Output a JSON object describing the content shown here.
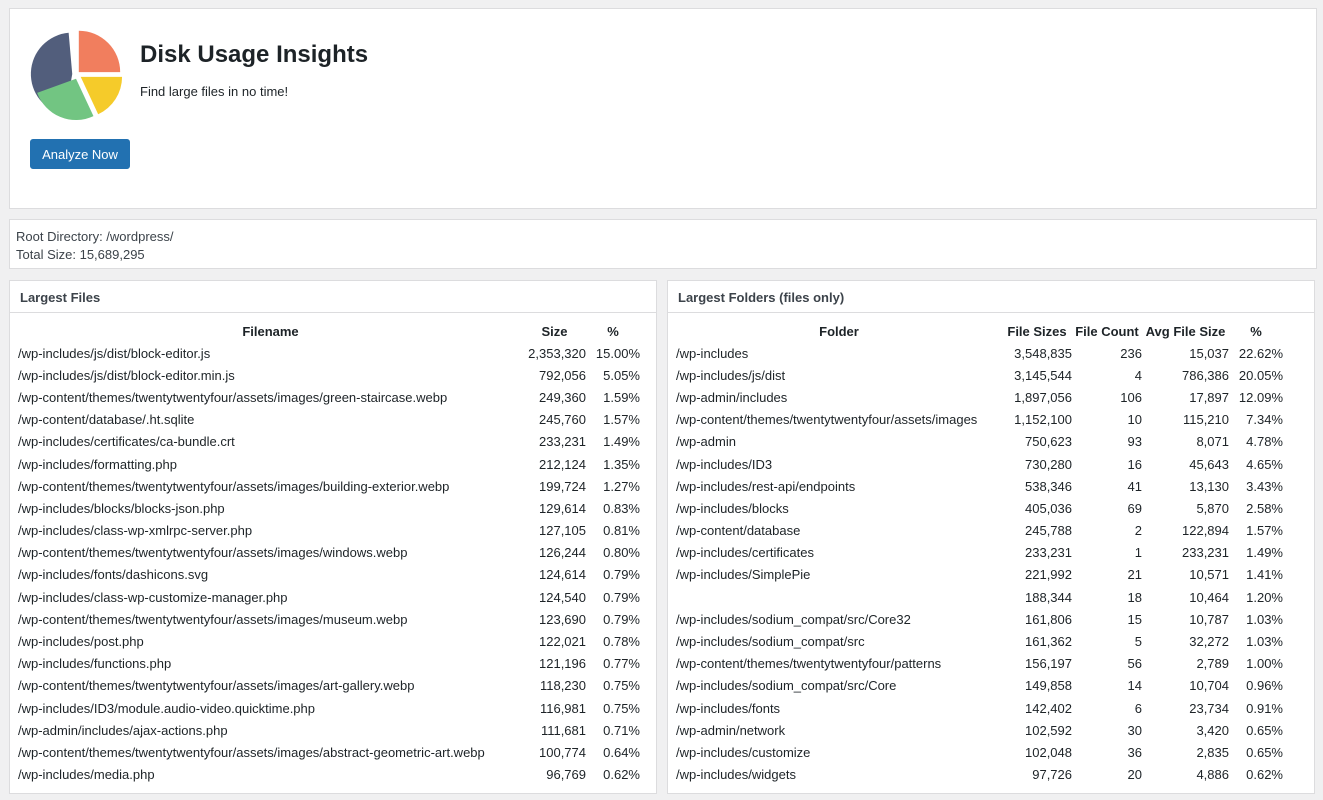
{
  "header": {
    "title": "Disk Usage Insights",
    "subtitle": "Find large files in no time!",
    "analyze_label": "Analyze Now",
    "logo_colors": [
      "#525e7c",
      "#f17e5e",
      "#f5cb2a",
      "#72c582"
    ]
  },
  "summary": {
    "root_directory": "Root Directory: /wordpress/",
    "total_size": "Total Size: 15,689,295"
  },
  "largest_files": {
    "heading": "Largest Files",
    "columns": [
      "Filename",
      "Size",
      "%"
    ],
    "rows": [
      [
        "/wp-includes/js/dist/block-editor.js",
        "2,353,320",
        "15.00%"
      ],
      [
        "/wp-includes/js/dist/block-editor.min.js",
        "792,056",
        "5.05%"
      ],
      [
        "/wp-content/themes/twentytwentyfour/assets/images/green-staircase.webp",
        "249,360",
        "1.59%"
      ],
      [
        "/wp-content/database/.ht.sqlite",
        "245,760",
        "1.57%"
      ],
      [
        "/wp-includes/certificates/ca-bundle.crt",
        "233,231",
        "1.49%"
      ],
      [
        "/wp-includes/formatting.php",
        "212,124",
        "1.35%"
      ],
      [
        "/wp-content/themes/twentytwentyfour/assets/images/building-exterior.webp",
        "199,724",
        "1.27%"
      ],
      [
        "/wp-includes/blocks/blocks-json.php",
        "129,614",
        "0.83%"
      ],
      [
        "/wp-includes/class-wp-xmlrpc-server.php",
        "127,105",
        "0.81%"
      ],
      [
        "/wp-content/themes/twentytwentyfour/assets/images/windows.webp",
        "126,244",
        "0.80%"
      ],
      [
        "/wp-includes/fonts/dashicons.svg",
        "124,614",
        "0.79%"
      ],
      [
        "/wp-includes/class-wp-customize-manager.php",
        "124,540",
        "0.79%"
      ],
      [
        "/wp-content/themes/twentytwentyfour/assets/images/museum.webp",
        "123,690",
        "0.79%"
      ],
      [
        "/wp-includes/post.php",
        "122,021",
        "0.78%"
      ],
      [
        "/wp-includes/functions.php",
        "121,196",
        "0.77%"
      ],
      [
        "/wp-content/themes/twentytwentyfour/assets/images/art-gallery.webp",
        "118,230",
        "0.75%"
      ],
      [
        "/wp-includes/ID3/module.audio-video.quicktime.php",
        "116,981",
        "0.75%"
      ],
      [
        "/wp-admin/includes/ajax-actions.php",
        "111,681",
        "0.71%"
      ],
      [
        "/wp-content/themes/twentytwentyfour/assets/images/abstract-geometric-art.webp",
        "100,774",
        "0.64%"
      ],
      [
        "/wp-includes/media.php",
        "96,769",
        "0.62%"
      ]
    ]
  },
  "largest_folders": {
    "heading": "Largest Folders (files only)",
    "columns": [
      "Folder",
      "File Sizes",
      "File Count",
      "Avg File Size",
      "%"
    ],
    "rows": [
      [
        "/wp-includes",
        "3,548,835",
        "236",
        "15,037",
        "22.62%"
      ],
      [
        "/wp-includes/js/dist",
        "3,145,544",
        "4",
        "786,386",
        "20.05%"
      ],
      [
        "/wp-admin/includes",
        "1,897,056",
        "106",
        "17,897",
        "12.09%"
      ],
      [
        "/wp-content/themes/twentytwentyfour/assets/images",
        "1,152,100",
        "10",
        "115,210",
        "7.34%"
      ],
      [
        "/wp-admin",
        "750,623",
        "93",
        "8,071",
        "4.78%"
      ],
      [
        "/wp-includes/ID3",
        "730,280",
        "16",
        "45,643",
        "4.65%"
      ],
      [
        "/wp-includes/rest-api/endpoints",
        "538,346",
        "41",
        "13,130",
        "3.43%"
      ],
      [
        "/wp-includes/blocks",
        "405,036",
        "69",
        "5,870",
        "2.58%"
      ],
      [
        "/wp-content/database",
        "245,788",
        "2",
        "122,894",
        "1.57%"
      ],
      [
        "/wp-includes/certificates",
        "233,231",
        "1",
        "233,231",
        "1.49%"
      ],
      [
        "/wp-includes/SimplePie",
        "221,992",
        "21",
        "10,571",
        "1.41%"
      ],
      [
        "",
        "188,344",
        "18",
        "10,464",
        "1.20%"
      ],
      [
        "/wp-includes/sodium_compat/src/Core32",
        "161,806",
        "15",
        "10,787",
        "1.03%"
      ],
      [
        "/wp-includes/sodium_compat/src",
        "161,362",
        "5",
        "32,272",
        "1.03%"
      ],
      [
        "/wp-content/themes/twentytwentyfour/patterns",
        "156,197",
        "56",
        "2,789",
        "1.00%"
      ],
      [
        "/wp-includes/sodium_compat/src/Core",
        "149,858",
        "14",
        "10,704",
        "0.96%"
      ],
      [
        "/wp-includes/fonts",
        "142,402",
        "6",
        "23,734",
        "0.91%"
      ],
      [
        "/wp-admin/network",
        "102,592",
        "30",
        "3,420",
        "0.65%"
      ],
      [
        "/wp-includes/customize",
        "102,048",
        "36",
        "2,835",
        "0.65%"
      ],
      [
        "/wp-includes/widgets",
        "97,726",
        "20",
        "4,886",
        "0.62%"
      ]
    ]
  }
}
